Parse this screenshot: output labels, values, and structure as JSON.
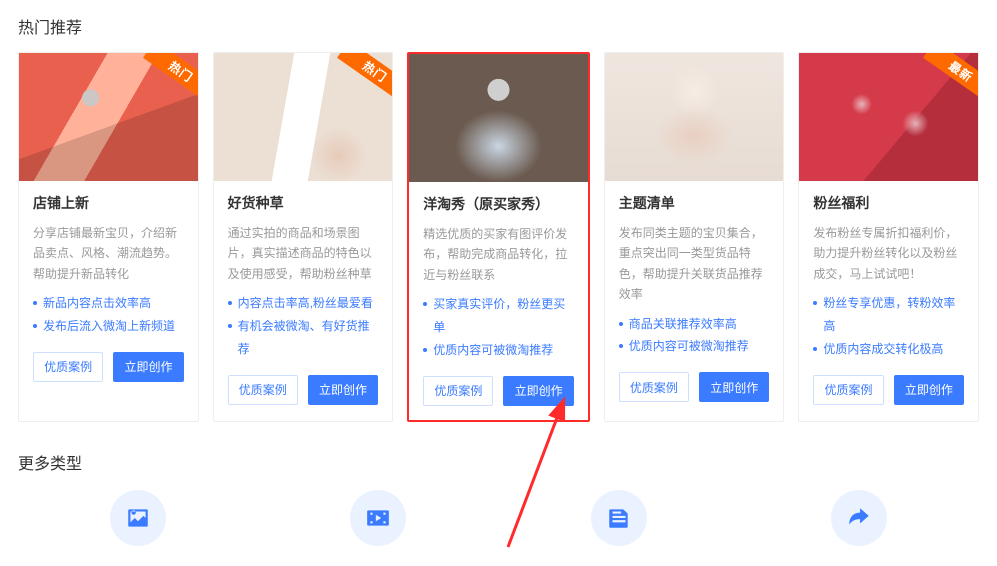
{
  "section_hot": {
    "title": "热门推荐"
  },
  "section_more": {
    "title": "更多类型"
  },
  "ribbons": {
    "hot": "热门",
    "new": "最新"
  },
  "buttons": {
    "example": "优质案例",
    "create": "立即创作"
  },
  "cards": [
    {
      "ribbon": "hot",
      "title": "店铺上新",
      "desc": "分享店铺最新宝贝，介绍新品卖点、风格、潮流趋势。帮助提升新品转化",
      "bullets": [
        "新品内容点击效率高",
        "发布后流入微淘上新频道"
      ]
    },
    {
      "ribbon": "hot",
      "title": "好货种草",
      "desc": "通过实拍的商品和场景图片，真实描述商品的特色以及使用感受，帮助粉丝种草",
      "bullets": [
        "内容点击率高,粉丝最爱看",
        "有机会被微淘、有好货推荐"
      ]
    },
    {
      "ribbon": null,
      "highlight": true,
      "title": "洋淘秀（原买家秀）",
      "desc": "精选优质的买家有图评价发布，帮助完成商品转化，拉近与粉丝联系",
      "bullets": [
        "买家真实评价，粉丝更买单",
        "优质内容可被微淘推荐"
      ]
    },
    {
      "ribbon": null,
      "title": "主题清单",
      "desc": "发布同类主题的宝贝集合，重点突出同一类型货品特色，帮助提升关联货品推荐效率",
      "bullets": [
        "商品关联推荐效率高",
        "优质内容可被微淘推荐"
      ]
    },
    {
      "ribbon": "new",
      "title": "粉丝福利",
      "desc": "发布粉丝专属折扣福利价，助力提升粉丝转化以及粉丝成交，马上试试吧！",
      "bullets": [
        "粉丝专享优惠，转粉效率高",
        "优质内容成交转化极高"
      ]
    }
  ],
  "more_types": [
    {
      "name": "image-icon"
    },
    {
      "name": "video-icon"
    },
    {
      "name": "article-icon"
    },
    {
      "name": "share-icon"
    }
  ]
}
